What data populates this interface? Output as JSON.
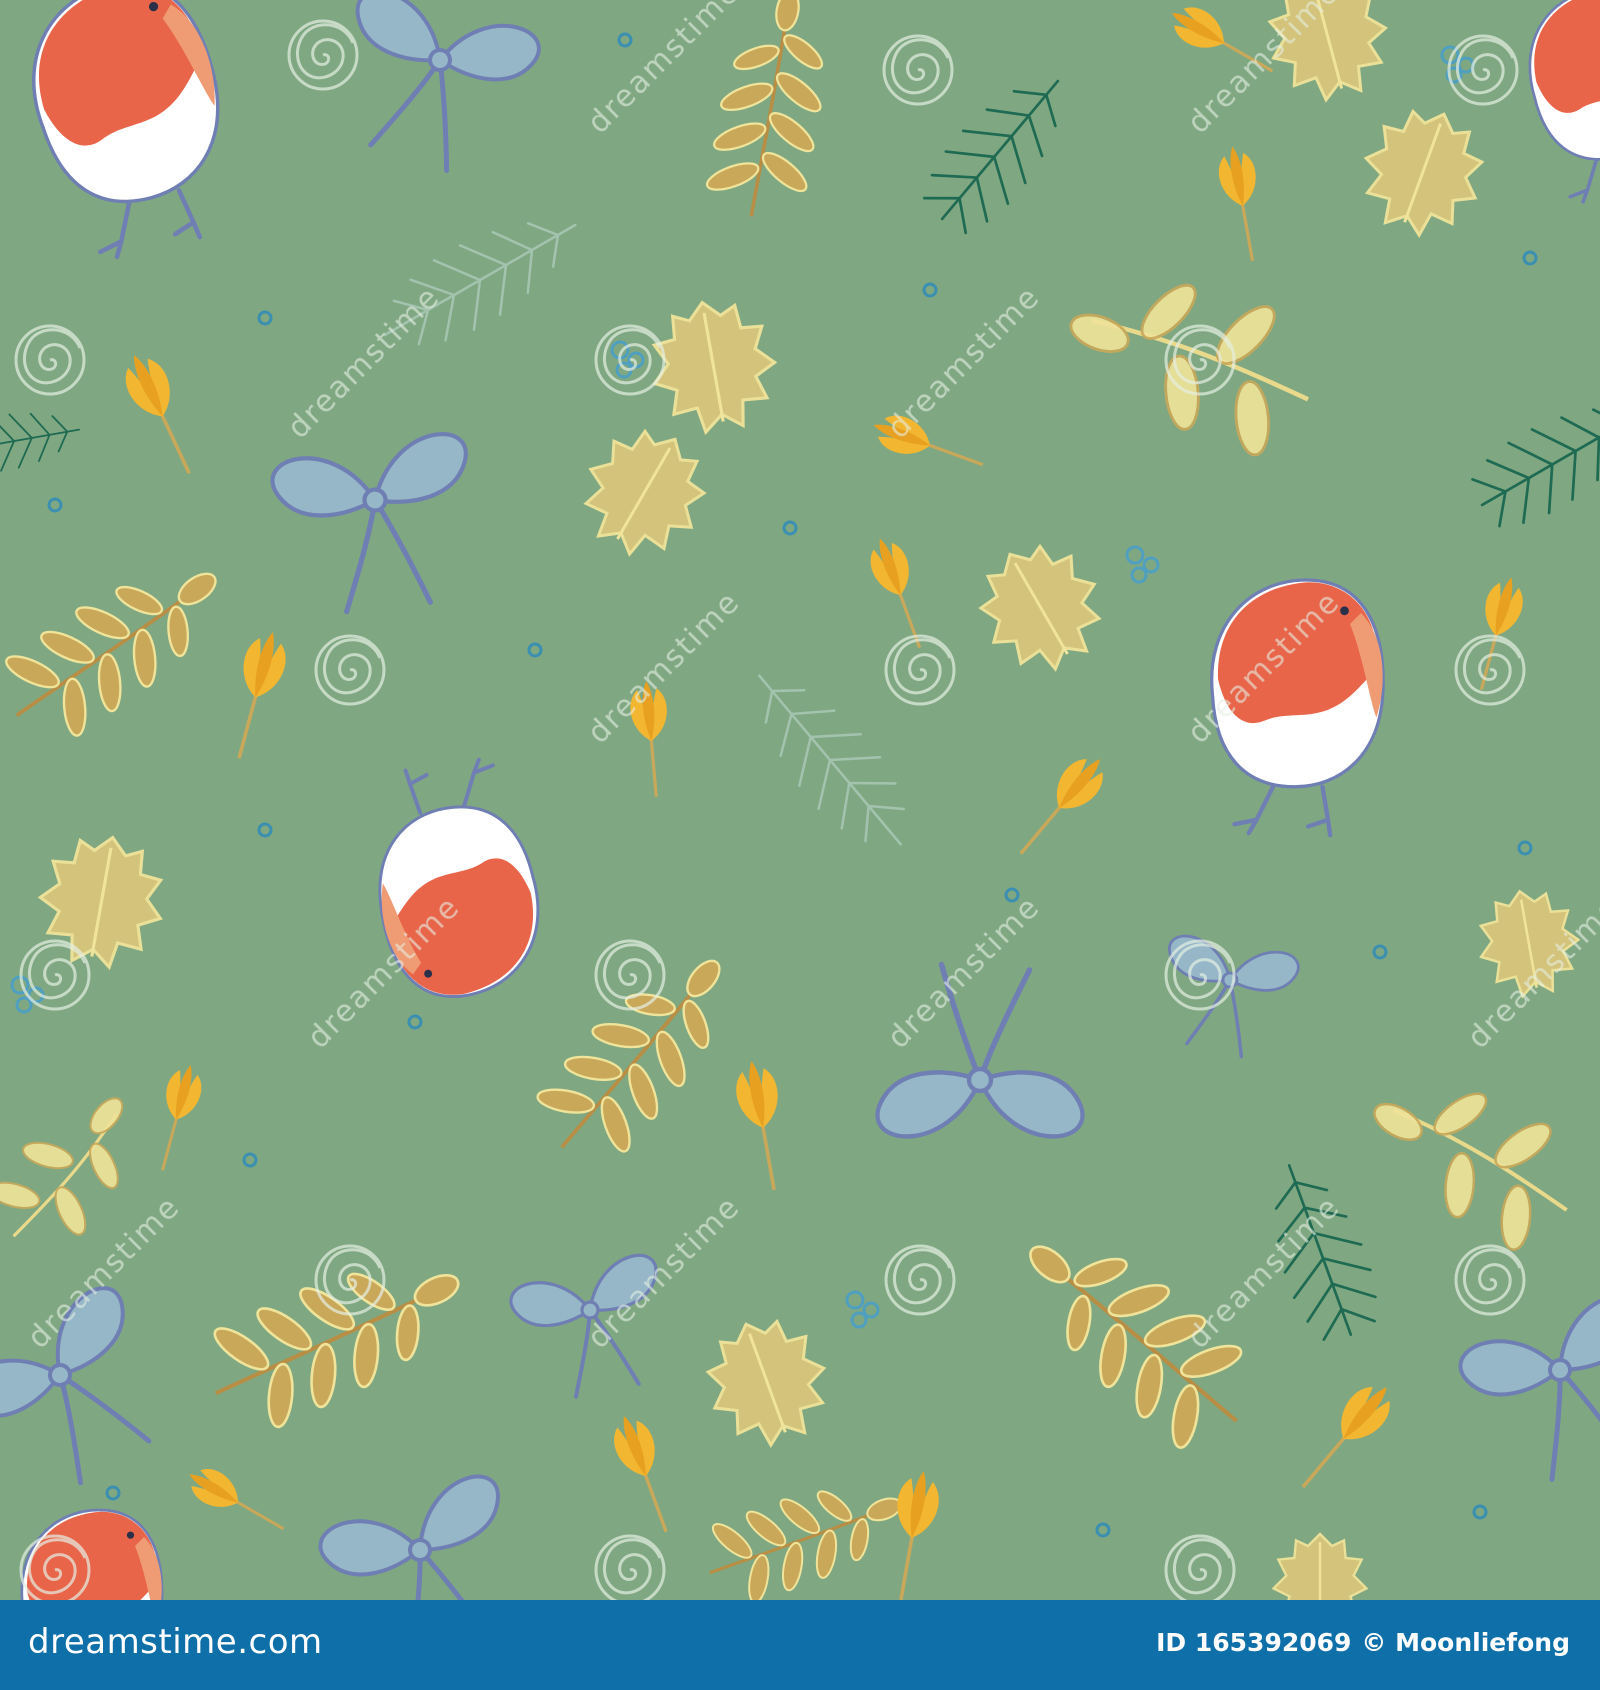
{
  "image": {
    "kind": "seamless pattern",
    "background_color": "#7fa882",
    "motifs": [
      "robin",
      "bow",
      "holly-leaf",
      "fern-branch",
      "pine-sprig",
      "crocus-flower",
      "berries"
    ]
  },
  "colors": {
    "robin_orange": "#e8654a",
    "robin_peach": "#ef9b73",
    "robin_white": "#ffffff",
    "bow_blue": "#95b7c8",
    "bow_outline": "#6f7fb3",
    "leaf_ochre": "#c9a85a",
    "leaf_cream": "#f0e49a",
    "crocus_yellow": "#f2b631",
    "pine_green": "#1f6a52",
    "berry_blue": "#3b8fb0",
    "watermark_white": "#e6f0e4",
    "footer_blue": "#0f6fa8"
  },
  "watermark": {
    "text": "dreamstime",
    "icon": "spiral-logo-icon"
  },
  "footer": {
    "site": "dreamstime.com",
    "id_text": "ID 165392069",
    "author": "© Moonliefong"
  }
}
